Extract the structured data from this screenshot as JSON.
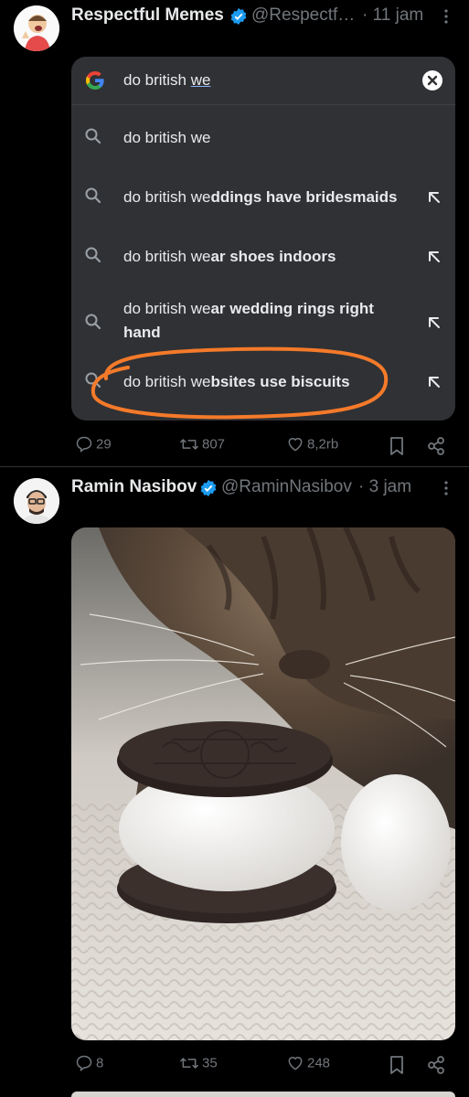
{
  "tweets": [
    {
      "author_name": "Respectful Memes",
      "handle": "@Respectf…",
      "time": "· 11 jam",
      "google": {
        "query_typed": "do british ",
        "query_underlined": "we",
        "suggestions": [
          {
            "prefix": "do british we",
            "bold": ""
          },
          {
            "prefix": "do british we",
            "bold": "ddings have bridesmaids"
          },
          {
            "prefix": "do british we",
            "bold": "ar shoes indoors"
          },
          {
            "prefix": "do british we",
            "bold": "ar wedding rings right",
            "line2": "hand"
          },
          {
            "prefix": "do british we",
            "bold": "bsites use biscuits"
          }
        ]
      },
      "actions": {
        "replies": "29",
        "reposts": "807",
        "likes": "8,2rb"
      }
    },
    {
      "author_name": "Ramin Nasibov",
      "handle": "@RaminNasibov",
      "time": "· 3 jam",
      "actions": {
        "replies": "8",
        "reposts": "35",
        "likes": "248"
      }
    }
  ],
  "colors": {
    "background": "#000000",
    "text": "#e7e9ea",
    "muted": "#71767b",
    "verified": "#1d9bf0",
    "google_card": "#303134",
    "highlight_circle": "#f47a2a"
  },
  "icons": [
    "verified-badge-icon",
    "more-icon",
    "google-logo-icon",
    "clear-icon",
    "search-icon",
    "arrow-up-left-icon",
    "reply-icon",
    "repost-icon",
    "like-icon",
    "bookmark-icon",
    "share-icon"
  ]
}
